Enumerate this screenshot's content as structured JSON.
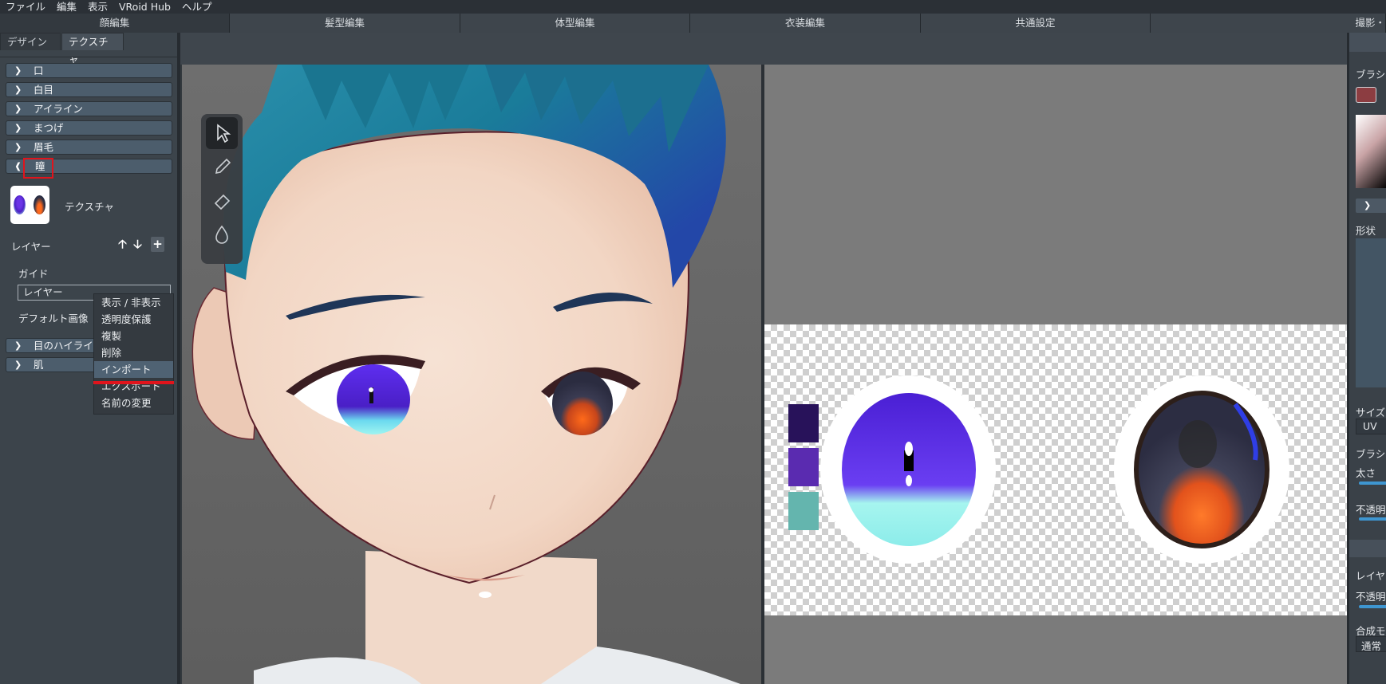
{
  "menu": [
    "ファイル",
    "編集",
    "表示",
    "VRoid Hub",
    "ヘルプ"
  ],
  "main_tabs": [
    "顔編集",
    "髪型編集",
    "体型編集",
    "衣装編集",
    "共通設定",
    "撮影・"
  ],
  "sub_tabs": [
    "デザイン",
    "テクスチャ"
  ],
  "sections": {
    "mouth": "口",
    "eyewhite": "白目",
    "eyeline": "アイライン",
    "eyelash": "まつげ",
    "eyebrow": "眉毛",
    "iris": "瞳",
    "eye_highlight": "目のハイライト",
    "skin": "肌"
  },
  "iris_panel": {
    "texture_label": "テクスチャ",
    "layer_label": "レイヤー",
    "layer_up": "🡡",
    "layer_down": "🡣",
    "layer_add": "+",
    "guide_label": "ガイド",
    "layer_item": "レイヤー",
    "default_image_label": "デフォルト画像"
  },
  "context_menu": [
    "表示 / 非表示",
    "透明度保護",
    "複製",
    "削除",
    "インポート",
    "エクスポート",
    "名前の変更"
  ],
  "context_menu_hover_index": 4,
  "tools": [
    "select-arrow-icon",
    "pen-icon",
    "eraser-icon",
    "fill-drop-icon"
  ],
  "texture_swatches": [
    "#28125a",
    "#5a2bb0",
    "#64b5ae"
  ],
  "colors": {
    "accent_red": "#e0141c",
    "brush_color": "#8c3d41",
    "slider_blue": "#3e96d1"
  },
  "right_panel": {
    "brush_label": "ブラシ",
    "shape_label": "形状",
    "size_label": "サイズ",
    "uv_label": "UV",
    "brush_label2": "ブラシ",
    "thickness_label": "太さ",
    "opacity_label": "不透明",
    "layer_label": "レイヤ",
    "opacity_label2": "不透明",
    "blend_label": "合成モ",
    "blend_value": "通常"
  }
}
